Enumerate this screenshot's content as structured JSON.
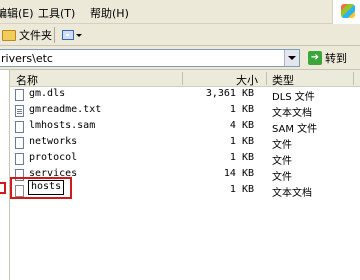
{
  "menu": {
    "edit": "编辑(E)",
    "tools": "工具(T)",
    "help": "帮助(H)"
  },
  "toolbar": {
    "folders_label": "文件夹",
    "views_icon": "views-icon"
  },
  "address": {
    "path": "rivers\\etc",
    "go_label": "转到"
  },
  "columns": {
    "name": "名称",
    "size": "大小",
    "type": "类型"
  },
  "files": [
    {
      "name": "gm.dls",
      "size": "3,361 KB",
      "type": "DLS 文件",
      "icon": "file-icon"
    },
    {
      "name": "gmreadme.txt",
      "size": "1 KB",
      "type": "文本文档",
      "icon": "text-document-icon"
    },
    {
      "name": "lmhosts.sam",
      "size": "4 KB",
      "type": "SAM 文件",
      "icon": "file-icon"
    },
    {
      "name": "networks",
      "size": "1 KB",
      "type": "文件",
      "icon": "file-icon"
    },
    {
      "name": "protocol",
      "size": "1 KB",
      "type": "文件",
      "icon": "file-icon"
    },
    {
      "name": "services",
      "size": "14 KB",
      "type": "文件",
      "icon": "file-icon"
    },
    {
      "name": "hosts",
      "size": "1 KB",
      "type": "文本文档",
      "icon": "text-document-icon"
    }
  ],
  "colors": {
    "highlight": "#d11b1b",
    "chrome": "#ece9d8",
    "header": "#ebeadb"
  }
}
